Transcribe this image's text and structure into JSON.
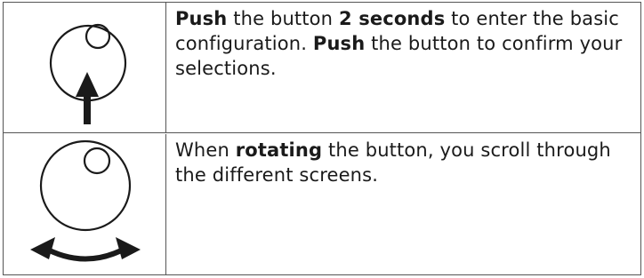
{
  "rows": [
    {
      "icon": "push-knob-icon",
      "text": {
        "b1": "Push",
        "t1": " the button ",
        "b2": "2 seconds",
        "t2": " to enter the basic configuration. ",
        "b3": "Push",
        "t3": " the button to confirm your selections."
      }
    },
    {
      "icon": "rotate-knob-icon",
      "text": {
        "t1": "When ",
        "b1": "rotating",
        "t2": " the button, you scroll through the different screens."
      }
    }
  ],
  "colors": {
    "border": "#555555",
    "ink": "#1a1a1a"
  }
}
